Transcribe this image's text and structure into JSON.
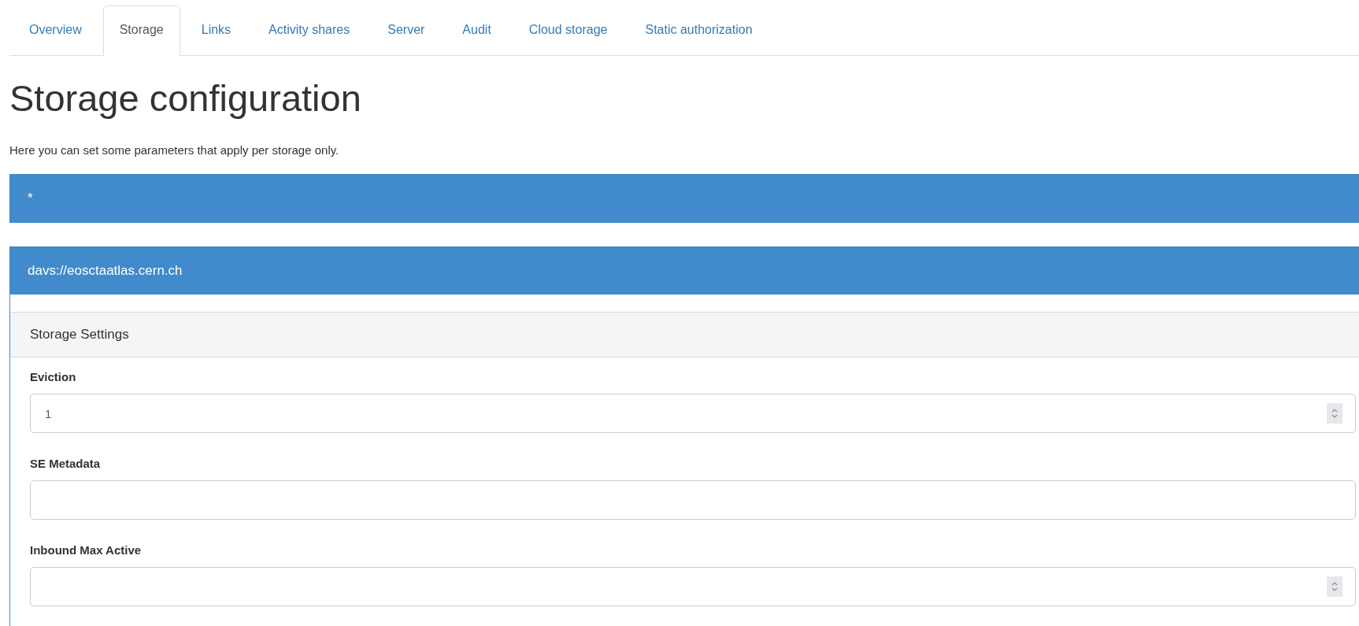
{
  "tabs": [
    {
      "label": "Overview",
      "selected": false
    },
    {
      "label": "Storage",
      "selected": true
    },
    {
      "label": "Links",
      "selected": false
    },
    {
      "label": "Activity shares",
      "selected": false
    },
    {
      "label": "Server",
      "selected": false
    },
    {
      "label": "Audit",
      "selected": false
    },
    {
      "label": "Cloud storage",
      "selected": false
    },
    {
      "label": "Static authorization",
      "selected": false
    }
  ],
  "heading": "Storage configuration",
  "description": "Here you can set some parameters that apply per storage only.",
  "storages": [
    {
      "title": "*",
      "expanded": false
    },
    {
      "title": "davs://eosctaatlas.cern.ch",
      "expanded": true,
      "section": "Storage Settings",
      "fields": [
        {
          "label": "Eviction",
          "kind": "number",
          "value": "1"
        },
        {
          "label": "SE Metadata",
          "kind": "text"
        },
        {
          "label": "Inbound Max Active",
          "kind": "number"
        }
      ]
    }
  ]
}
